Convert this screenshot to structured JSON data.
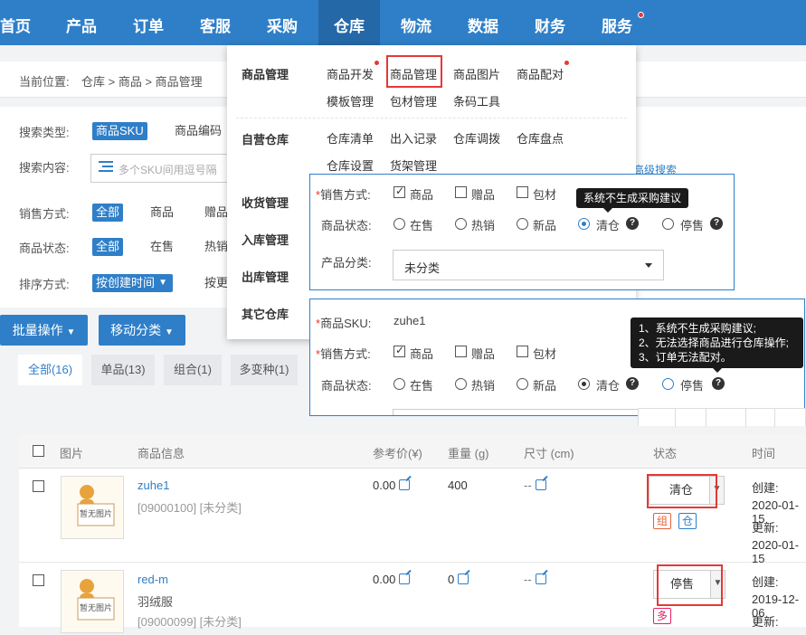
{
  "nav": {
    "items": [
      {
        "label": "首页"
      },
      {
        "label": "产品"
      },
      {
        "label": "订单"
      },
      {
        "label": "客服"
      },
      {
        "label": "采购"
      },
      {
        "label": "仓库"
      },
      {
        "label": "物流"
      },
      {
        "label": "数据"
      },
      {
        "label": "财务"
      },
      {
        "label": "服务"
      }
    ],
    "active": "仓库",
    "accent": "#2f7fc8"
  },
  "breadcrumb": {
    "label": "当前位置:",
    "path": "仓库 > 商品 > 商品管理"
  },
  "search": {
    "type_label": "搜索类型:",
    "type_options": [
      "商品SKU",
      "商品编码"
    ],
    "content_label": "搜索内容:",
    "content_placeholder": "多个SKU间用逗号隔",
    "advanced": "高级搜索",
    "sale_label": "销售方式:",
    "sale_options": [
      "全部",
      "商品",
      "赠品"
    ],
    "status_label": "商品状态:",
    "status_options": [
      "全部",
      "在售",
      "热销"
    ],
    "sort_label": "排序方式:",
    "sort_options": [
      "按创建时间",
      "按更新"
    ]
  },
  "toolbar": {
    "batch": "批量操作",
    "move": "移动分类"
  },
  "tabs": [
    "全部(16)",
    "单品(13)",
    "组合(1)",
    "多变种(1)"
  ],
  "table": {
    "headers": [
      "图片",
      "商品信息",
      "参考价(¥)",
      "重量 (g)",
      "尺寸 (cm)",
      "状态",
      "时间"
    ],
    "placeholder_img": "暂无图片",
    "rows": [
      {
        "name": "zuhe1",
        "subtitle": "",
        "code": "[09000100] [未分类]",
        "price": "0.00",
        "weight": "400",
        "size": "--",
        "status": "清仓",
        "badges": [
          "组",
          "仓"
        ],
        "created_label": "创建:",
        "created": "2020-01-15",
        "updated_label": "更新:",
        "updated": "2020-01-15"
      },
      {
        "name": "red-m",
        "subtitle": "羽绒服",
        "code": "[09000099] [未分类]",
        "price": "0.00",
        "weight": "0",
        "size": "--",
        "status": "停售",
        "badges": [
          "多"
        ],
        "created_label": "创建:",
        "created": "2019-12-06",
        "updated_label": "更新:",
        "updated": ""
      }
    ]
  },
  "dropdown": {
    "categories": [
      "商品管理",
      "自营仓库",
      "收货管理",
      "入库管理",
      "出库管理",
      "其它仓库"
    ],
    "links_row1": [
      "商品开发",
      "商品管理",
      "商品图片",
      "商品配对"
    ],
    "links_row2": [
      "模板管理",
      "包材管理",
      "条码工具"
    ],
    "links_row3": [
      "仓库清单",
      "出入记录",
      "仓库调拨",
      "仓库盘点"
    ],
    "links_row4": [
      "仓库设置",
      "货架管理"
    ]
  },
  "popup1": {
    "sale_label": "销售方式:",
    "sale_options": [
      "商品",
      "赠品",
      "包材"
    ],
    "status_label": "商品状态:",
    "status_options": [
      "在售",
      "热销",
      "新品",
      "清仓",
      "停售"
    ],
    "category_label": "产品分类:",
    "category_value": "未分类",
    "tooltip": "系统不生成采购建议"
  },
  "popup2": {
    "sku_label": "商品SKU:",
    "sku_value": "zuhe1",
    "sale_label": "销售方式:",
    "sale_options": [
      "商品",
      "赠品",
      "包材"
    ],
    "status_label": "商品状态:",
    "status_options": [
      "在售",
      "热销",
      "新品",
      "清仓",
      "停售"
    ],
    "tooltip_lines": [
      "1、系统不生成采购建议;",
      "2、无法选择商品进行仓库操作;",
      "3、订单无法配对。"
    ]
  }
}
